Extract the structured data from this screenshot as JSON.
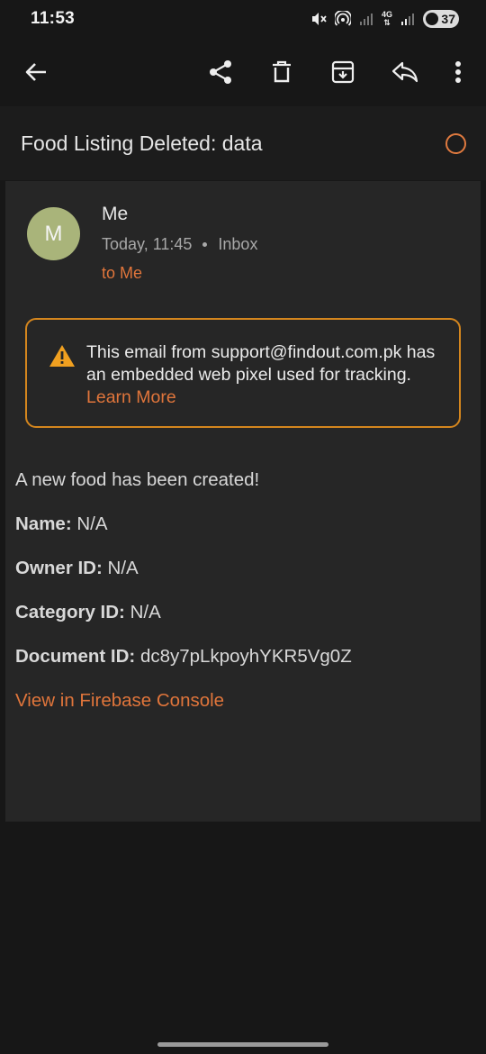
{
  "status_bar": {
    "time": "11:53",
    "network": "4G",
    "battery": "37",
    "icons": [
      "mute-icon",
      "hotspot-icon",
      "signal-icon",
      "4g-icon",
      "signal-icon",
      "battery-icon"
    ]
  },
  "toolbar": {
    "icons": [
      "back-arrow-icon",
      "share-icon",
      "delete-icon",
      "archive-icon",
      "reply-icon",
      "more-vert-icon"
    ]
  },
  "subject": "Food Listing Deleted: data",
  "message": {
    "avatar_letter": "M",
    "sender": "Me",
    "time": "Today, 11:45",
    "folder": "Inbox",
    "recipient": "to Me"
  },
  "warning": {
    "text": "This email from support@findout.com.pk has an embedded web pixel used for tracking.",
    "link": "Learn More"
  },
  "body": {
    "intro": "A new food has been created!",
    "name_label": "Name:",
    "name_value": "N/A",
    "owner_label": "Owner ID:",
    "owner_value": "N/A",
    "category_label": "Category ID:",
    "category_value": "N/A",
    "document_label": "Document ID:",
    "document_value": "dc8y7pLkpoyhYKR5Vg0Z",
    "console_link": "View in Firebase Console"
  },
  "colors": {
    "accent": "#e0753b",
    "warning_border": "#d4861e",
    "warning_icon": "#f0a020",
    "avatar": "#a9b47a",
    "background": "#171717",
    "card": "#262626"
  }
}
